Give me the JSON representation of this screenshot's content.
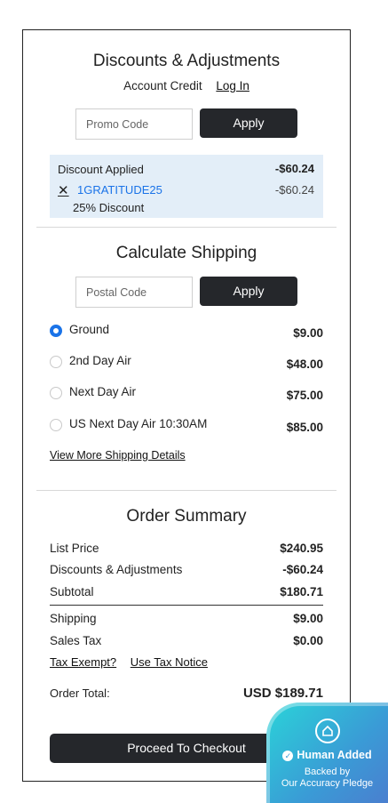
{
  "discounts": {
    "title": "Discounts & Adjustments",
    "account_credit": "Account Credit",
    "login_link": "Log In",
    "promo_placeholder": "Promo Code",
    "apply_label": "Apply",
    "applied": {
      "label": "Discount Applied",
      "total": "-$60.24",
      "code": "1GRATITUDE25",
      "code_amount": "-$60.24",
      "description": "25% Discount"
    }
  },
  "shipping": {
    "title": "Calculate Shipping",
    "postal_placeholder": "Postal Code",
    "apply_label": "Apply",
    "options": [
      {
        "label": "Ground",
        "price": "$9.00",
        "selected": true
      },
      {
        "label": "2nd Day Air",
        "price": "$48.00",
        "selected": false
      },
      {
        "label": "Next Day Air",
        "price": "$75.00",
        "selected": false
      },
      {
        "label": "US Next Day Air 10:30AM",
        "price": "$85.00",
        "selected": false
      }
    ],
    "details_link": "View More Shipping Details"
  },
  "summary": {
    "title": "Order Summary",
    "list_price_label": "List Price",
    "list_price": "$240.95",
    "discounts_label": "Discounts & Adjustments",
    "discounts": "-$60.24",
    "subtotal_label": "Subtotal",
    "subtotal": "$180.71",
    "shipping_label": "Shipping",
    "shipping": "$9.00",
    "tax_label": "Sales Tax",
    "tax": "$0.00",
    "tax_exempt_link": "Tax Exempt?",
    "use_tax_link": "Use Tax Notice",
    "total_label": "Order Total:",
    "total": "USD $189.71",
    "checkout_label": "Proceed To Checkout"
  },
  "badge": {
    "title": "Human Added",
    "line1": "Backed by",
    "line2": "Our Accuracy Pledge",
    "icon": "house-shield-icon"
  },
  "colors": {
    "accent": "#1a73e8",
    "dark_button": "#25272b",
    "discount_bg": "#e3eef8",
    "promo_code": "#1a73e8"
  }
}
